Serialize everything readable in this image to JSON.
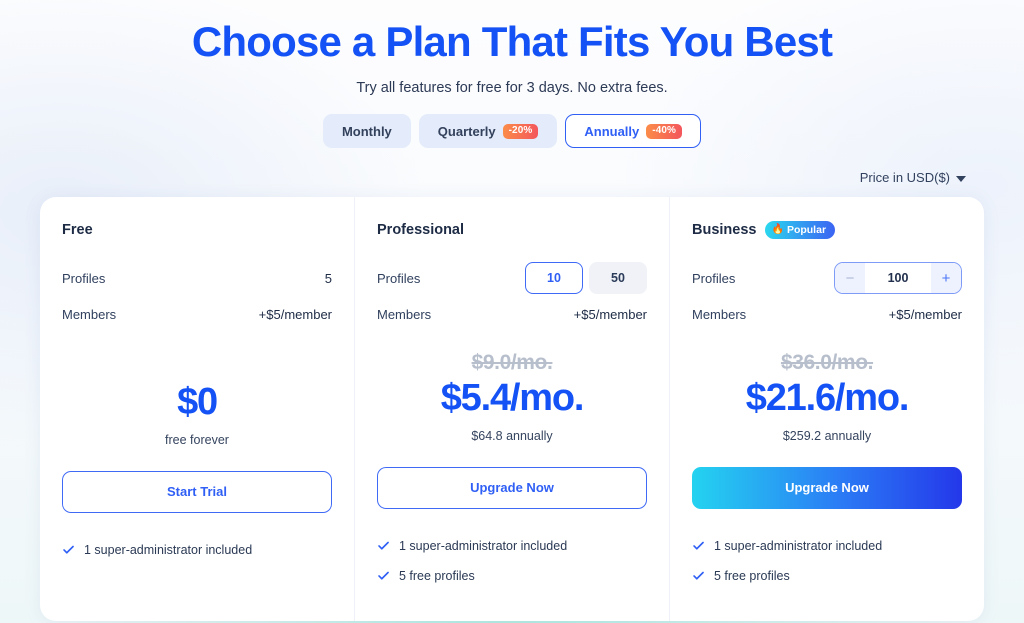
{
  "header": {
    "title": "Choose a Plan That Fits You Best",
    "subtitle": "Try all features for free for 3 days. No extra fees."
  },
  "billing_toggle": {
    "options": [
      {
        "label": "Monthly",
        "badge": "",
        "selected": false
      },
      {
        "label": "Quarterly",
        "badge": "-20%",
        "selected": false
      },
      {
        "label": "Annually",
        "badge": "-40%",
        "selected": true
      }
    ]
  },
  "currency": {
    "label": "Price in USD($)",
    "icon": "chevron-down-icon"
  },
  "plans": [
    {
      "name": "Free",
      "badge": "",
      "profiles_label": "Profiles",
      "profiles_value": "5",
      "members_label": "Members",
      "members_value": "+$5/member",
      "price_old": "",
      "price_main": "$0",
      "price_note": "free forever",
      "cta_label": "Start Trial",
      "cta_style": "outline",
      "features": [
        "1 super-administrator included"
      ]
    },
    {
      "name": "Professional",
      "badge": "",
      "profiles_label": "Profiles",
      "profile_options": [
        {
          "value": "10",
          "selected": true
        },
        {
          "value": "50",
          "selected": false
        }
      ],
      "members_label": "Members",
      "members_value": "+$5/member",
      "price_old": "$9.0/mo.",
      "price_main": "$5.4/mo.",
      "price_note": "$64.8 annually",
      "cta_label": "Upgrade Now",
      "cta_style": "outline",
      "features": [
        "1 super-administrator included",
        "5 free profiles"
      ]
    },
    {
      "name": "Business",
      "badge": "Popular",
      "badge_icon": "flame-icon",
      "profiles_label": "Profiles",
      "stepper": {
        "minus_label": "−",
        "value": "100",
        "plus_label": "+"
      },
      "members_label": "Members",
      "members_value": "+$5/member",
      "price_old": "$36.0/mo.",
      "price_main": "$21.6/mo.",
      "price_note": "$259.2 annually",
      "cta_label": "Upgrade Now",
      "cta_style": "gradient",
      "features": [
        "1 super-administrator included",
        "5 free profiles"
      ]
    }
  ],
  "colors": {
    "brand_blue": "#1452f5",
    "accent_cyan": "#24d3f0",
    "badge_orange": "#fb8d49",
    "badge_red": "#f3555c",
    "text_dark": "#1d2b45",
    "bg_mint": "#74e2c9"
  }
}
